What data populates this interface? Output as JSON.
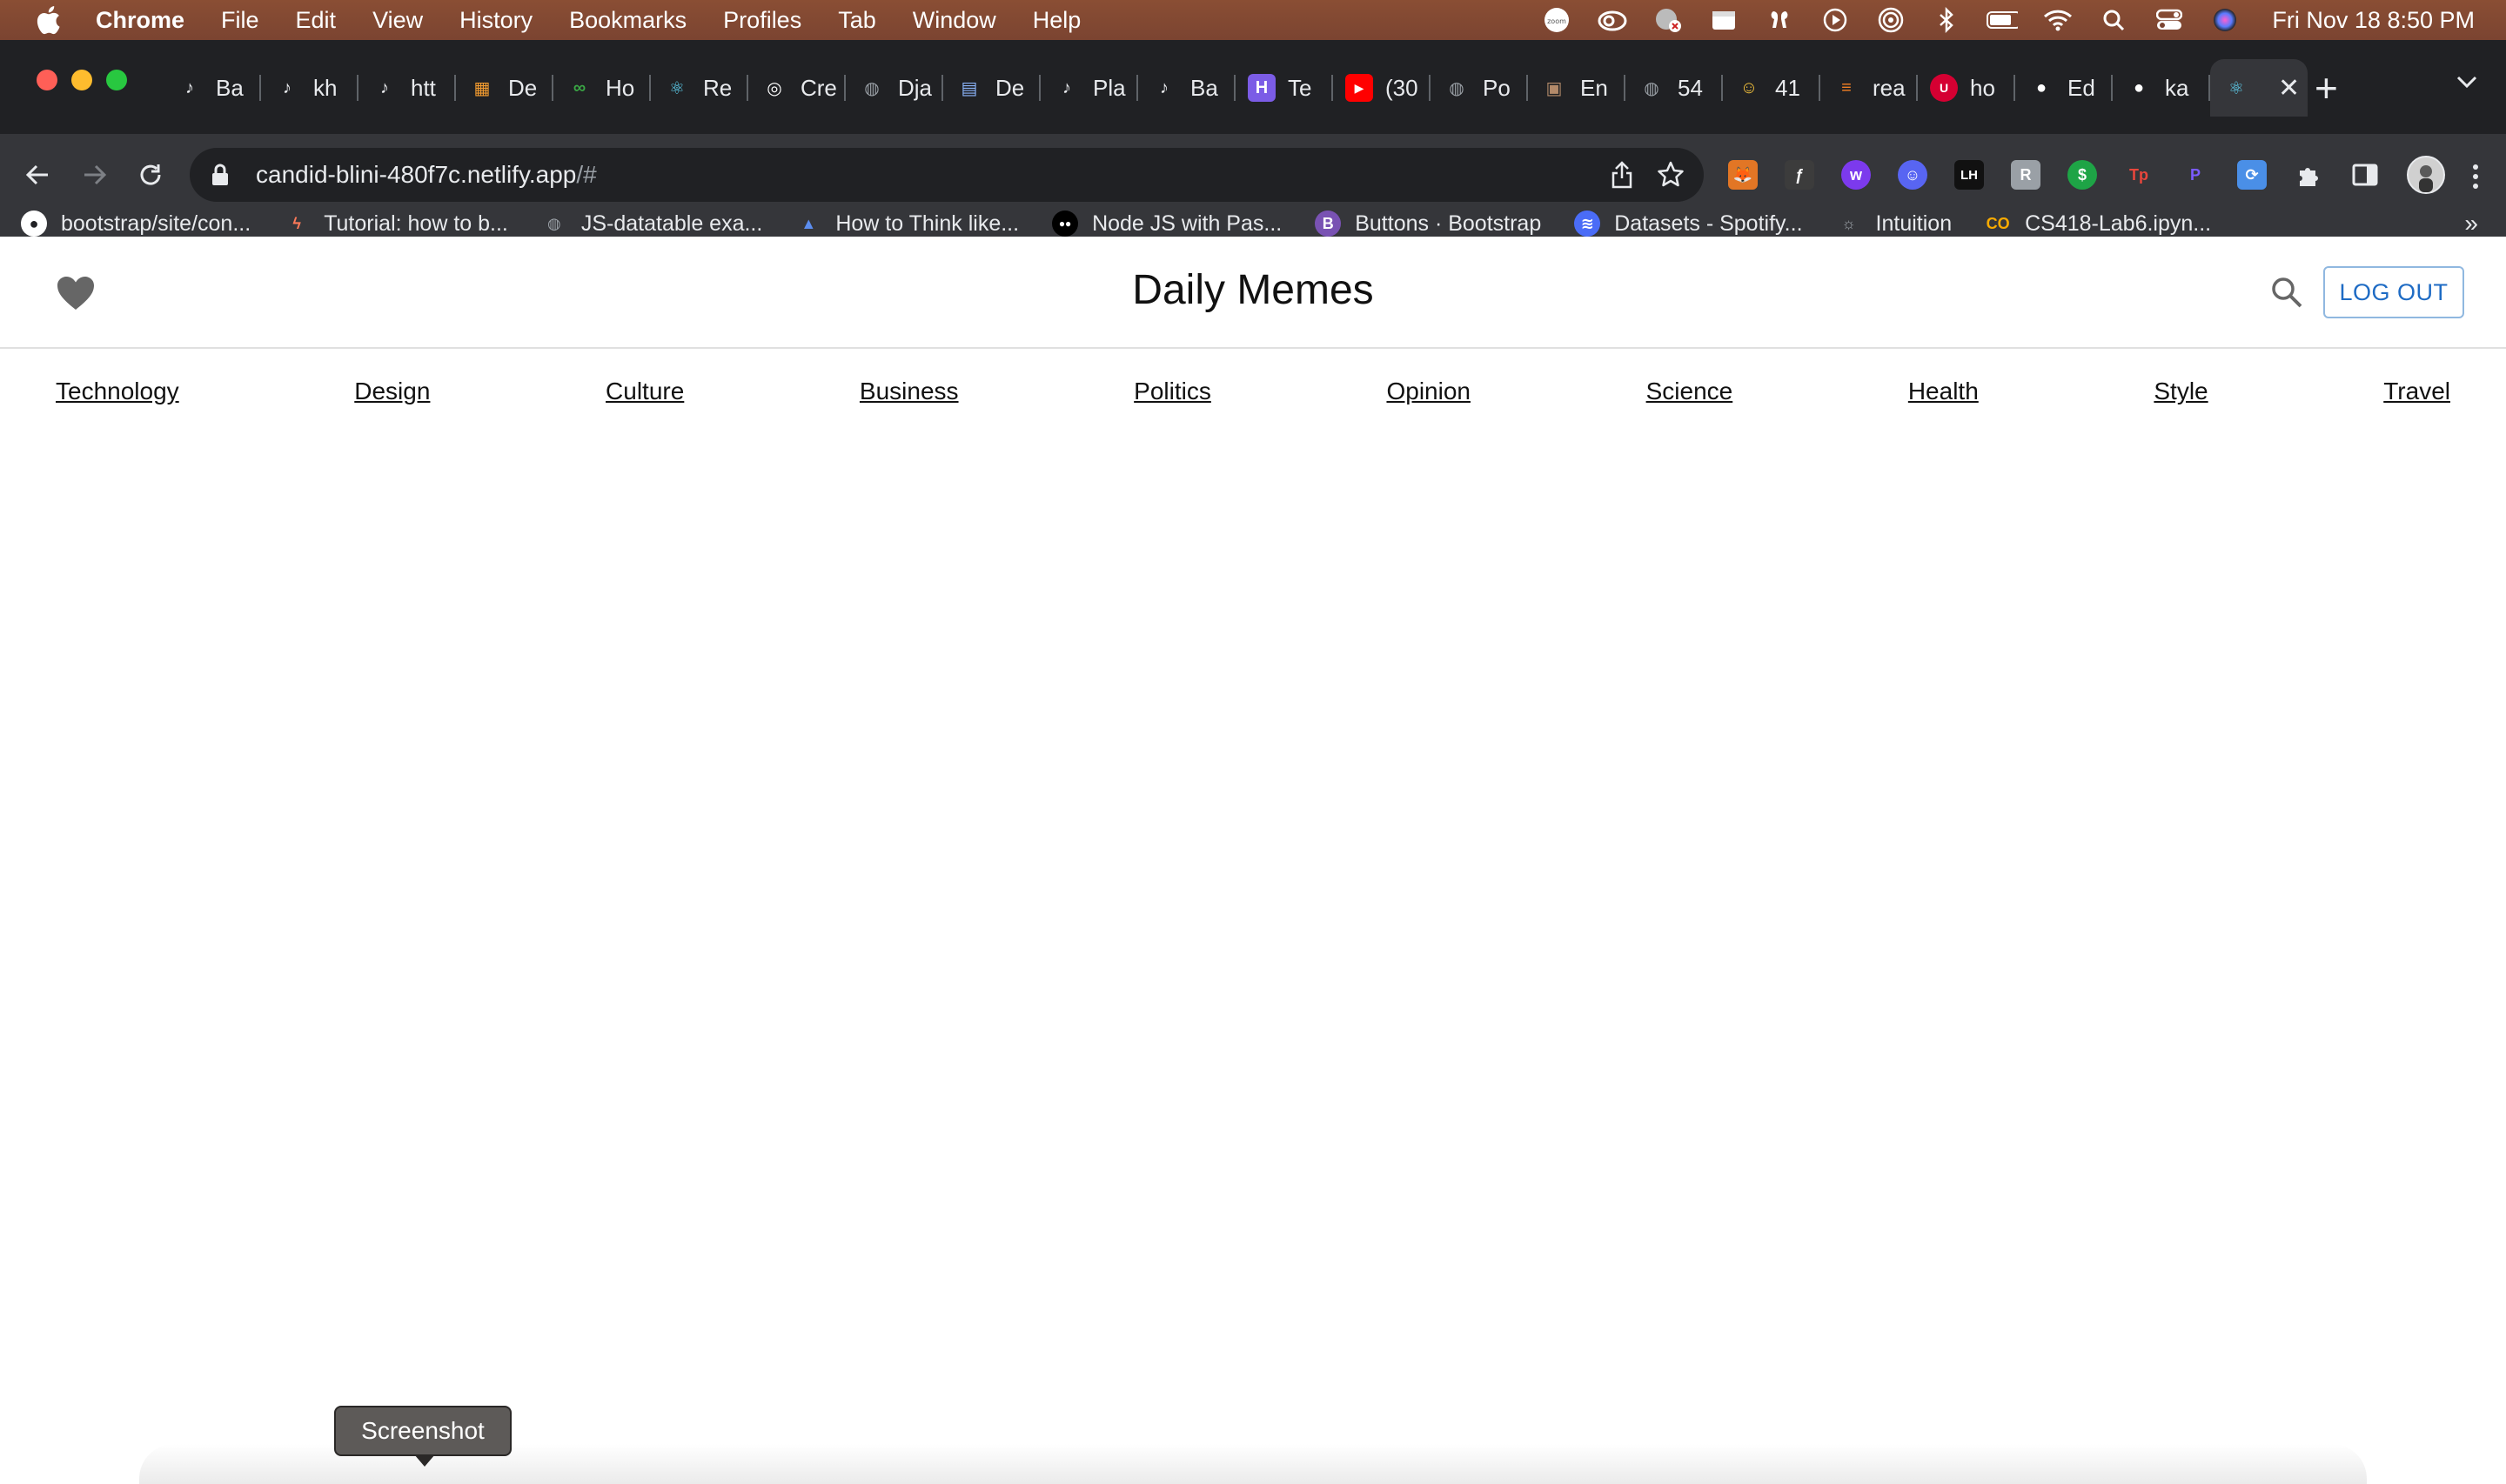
{
  "menubar": {
    "app": "Chrome",
    "items": [
      "File",
      "Edit",
      "View",
      "History",
      "Bookmarks",
      "Profiles",
      "Tab",
      "Window",
      "Help"
    ],
    "clock": "Fri Nov 18  8:50 PM"
  },
  "tabs": [
    {
      "title": "Ba",
      "icon": "tiktok-icon",
      "color": "#000000"
    },
    {
      "title": "kh",
      "icon": "tiktok-icon",
      "color": "#000000"
    },
    {
      "title": "htt",
      "icon": "tiktok-icon",
      "color": "#000000"
    },
    {
      "title": "De",
      "icon": "bookmark-orange-icon",
      "color": "#f29b2f"
    },
    {
      "title": "Ho",
      "icon": "link-green-icon",
      "color": "#3aa745"
    },
    {
      "title": "Re",
      "icon": "react-icon",
      "color": "#61dafb"
    },
    {
      "title": "Cre",
      "icon": "circle-dot-icon",
      "color": "#ffffff"
    },
    {
      "title": "Dja",
      "icon": "globe-icon",
      "color": "#9aa0a6"
    },
    {
      "title": "De",
      "icon": "book-icon",
      "color": "#8ab4f8"
    },
    {
      "title": "Pla",
      "icon": "tiktok-icon",
      "color": "#000000"
    },
    {
      "title": "Ba",
      "icon": "tiktok-icon",
      "color": "#000000"
    },
    {
      "title": "Te",
      "icon": "heroku-icon",
      "color": "#7b5ce6"
    },
    {
      "title": "(30",
      "icon": "youtube-icon",
      "color": "#ff0000"
    },
    {
      "title": "Po",
      "icon": "globe-icon",
      "color": "#9aa0a6"
    },
    {
      "title": "En",
      "icon": "image-icon",
      "color": "#b38a6a"
    },
    {
      "title": "54",
      "icon": "globe-icon",
      "color": "#9aa0a6"
    },
    {
      "title": "41",
      "icon": "smiley-icon",
      "color": "#f6c33b"
    },
    {
      "title": "rea",
      "icon": "stackoverflow-icon",
      "color": "#f48024"
    },
    {
      "title": "ho",
      "icon": "uic-icon",
      "color": "#d50032"
    },
    {
      "title": "Ed",
      "icon": "github-icon",
      "color": "#ffffff"
    },
    {
      "title": "ka",
      "icon": "github-icon",
      "color": "#ffffff"
    },
    {
      "title": "",
      "icon": "react-icon",
      "color": "#61dafb",
      "active": true
    }
  ],
  "address": {
    "host": "candid-blini-480f7c.netlify.app",
    "path": "/#"
  },
  "bookmarks": [
    {
      "label": "bootstrap/site/con...",
      "icon": "github-icon"
    },
    {
      "label": "Tutorial: how to b...",
      "icon": "tutorial-icon"
    },
    {
      "label": "JS-datatable exa...",
      "icon": "globe-icon"
    },
    {
      "label": "How to Think like...",
      "icon": "triangle-icon"
    },
    {
      "label": "Node JS with Pas...",
      "icon": "medium-icon"
    },
    {
      "label": "Buttons · Bootstrap",
      "icon": "bootstrap-icon"
    },
    {
      "label": "Datasets - Spotify...",
      "icon": "spotify-icon"
    },
    {
      "label": "Intuition",
      "icon": "bulb-icon"
    },
    {
      "label": "CS418-Lab6.ipyn...",
      "icon": "colab-icon"
    }
  ],
  "site": {
    "title": "Daily Memes",
    "logout": "LOG OUT",
    "categories": [
      "Technology",
      "Design",
      "Culture",
      "Business",
      "Politics",
      "Opinion",
      "Science",
      "Health",
      "Style",
      "Travel"
    ]
  },
  "tooltip": "Screenshot",
  "colors": {
    "menubar": "#7f4733",
    "chrome_dark": "#202124",
    "toolbar": "#35363a",
    "logout_text": "#1e6bc4",
    "heart": "#666666"
  }
}
